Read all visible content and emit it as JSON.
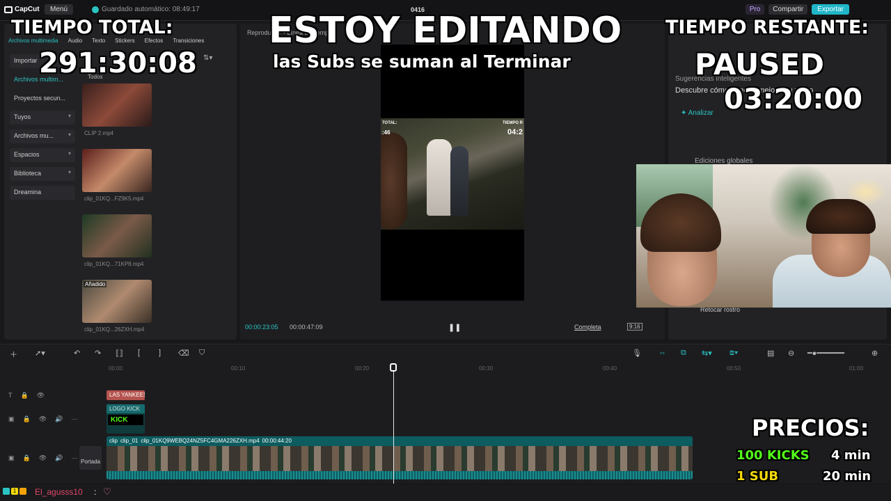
{
  "app": {
    "logo": "CapCut",
    "menu_label": "Menú",
    "autosave": "Guardado automático: 08:49:17",
    "project_name": "0416",
    "pro_label": "Pro",
    "share_label": "Compartir",
    "export_label": "Exportar"
  },
  "left_panel": {
    "tabs": [
      "Archivos multimedia",
      "Audio",
      "Texto",
      "Stickers",
      "Efectos",
      "Transiciones"
    ],
    "nav": [
      "Importar",
      "Archivos multim...",
      "Proyectos secun...",
      "Tuyos",
      "Archivos mu...",
      "Espacios",
      "Biblioteca",
      "Dreamina"
    ],
    "filter_label": "Todos",
    "clips": [
      {
        "name": "CLIP 2.mp4",
        "tag": ""
      },
      {
        "name": "clip_01KQ...FZ9K5.mp4",
        "tag": ""
      },
      {
        "name": "clip_01KQ...71KP8.mp4",
        "tag": ""
      },
      {
        "name": "clip_01KQ...26ZXH.mp4",
        "tag": "Añadido"
      }
    ]
  },
  "player": {
    "header": "Reproductor - Línea de tiempo",
    "current_time": "00:00:23:05",
    "total_time": "00:00:47:09",
    "play_icon": "pause-icon",
    "completa_label": "Completa",
    "ratio_label": "9:16",
    "preview_labels": {
      "total_lbl": "TOTAL:",
      "total_val": ":46",
      "rest_lbl": "TIEMPO R",
      "rest_val": "04:2"
    }
  },
  "right_panel": {
    "suggestions_title": "Sugerencias inteligentes",
    "suggestions_desc": "Descubre cómo puedes mejorar tu video",
    "analyze_label": "Analizar",
    "global_edits": "Ediciones globales",
    "retouch_label": "Retocar rostro"
  },
  "timeline": {
    "ruler": [
      "00:00",
      "00:10",
      "00:20",
      "00:30",
      "00:40",
      "00:50",
      "01:00"
    ],
    "text_clip": "LAS YANKEES",
    "logo_clip_label": "LOGO KICK",
    "logo_clip_text": "KICK",
    "main_clip_prefix1": "clip",
    "main_clip_prefix2": "clip_01",
    "main_clip_name": "clip_01KQ9WEBQ24NZ5FC4GMA226ZXH.mp4",
    "main_clip_duration": "00:00:44:20",
    "cover_label": "Portada"
  },
  "chat": {
    "badge_count": "1",
    "user": "El_agusss10",
    "separator": ":"
  },
  "overlay": {
    "total_label": "TIEMPO TOTAL:",
    "total_value": "291:30:08",
    "headline": "ESTOY EDITANDO",
    "subline": "las Subs se suman al Terminar",
    "remaining_label": "TIEMPO RESTANTE:",
    "status": "PAUSED",
    "remaining_value": "03:20:00",
    "prices_title": "PRECIOS:",
    "prices": [
      {
        "item": "100 KICKS",
        "time": "4 min"
      },
      {
        "item": "1 SUB",
        "time": "20 min"
      }
    ]
  },
  "colors": {
    "accent": "#2bc4c4",
    "kick_green": "#53fc18",
    "sub_yellow": "#f5d90a",
    "chat_user": "#e0466a"
  }
}
